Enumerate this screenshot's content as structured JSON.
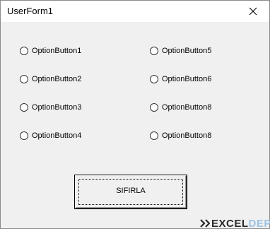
{
  "window": {
    "title": "UserForm1"
  },
  "options": [
    {
      "label": "OptionButton1"
    },
    {
      "label": "OptionButton2"
    },
    {
      "label": "OptionButton3"
    },
    {
      "label": "OptionButton4"
    },
    {
      "label": "OptionButton5"
    },
    {
      "label": "OptionButton6"
    },
    {
      "label": "OptionButton8"
    },
    {
      "label": "OptionButton8"
    }
  ],
  "button": {
    "label": "SIFIRLA"
  },
  "watermark": {
    "part1": "EXCEL",
    "part2": "DEPO"
  }
}
